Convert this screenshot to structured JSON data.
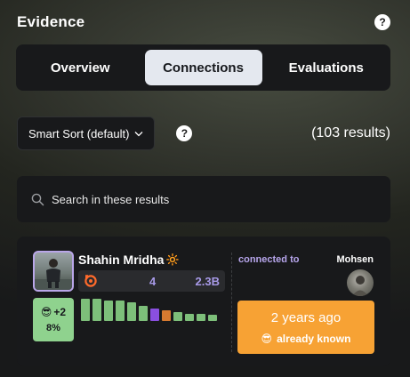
{
  "header": {
    "title": "Evidence",
    "help_icon": "?"
  },
  "tabs": [
    {
      "label": "Overview",
      "active": false
    },
    {
      "label": "Connections",
      "active": true
    },
    {
      "label": "Evaluations",
      "active": false
    }
  ],
  "sort": {
    "label": "Smart Sort (default)",
    "help_icon": "?"
  },
  "results": {
    "text": "(103 results)"
  },
  "search": {
    "placeholder": "Search in these results"
  },
  "card": {
    "name": "Shahin Mridha",
    "name_emoji": "🔆",
    "stat_a": "4",
    "stat_b": "2.3B",
    "badge_emoji": "😎",
    "badge_delta": "+2",
    "badge_percent": "8%",
    "bars": [
      {
        "value": 0.95,
        "color": "#7dbf7a"
      },
      {
        "value": 0.95,
        "color": "#7dbf7a"
      },
      {
        "value": 0.9,
        "color": "#7dbf7a"
      },
      {
        "value": 0.9,
        "color": "#7dbf7a"
      },
      {
        "value": 0.8,
        "color": "#7dbf7a"
      },
      {
        "value": 0.65,
        "color": "#7dbf7a"
      },
      {
        "value": 0.55,
        "color": "#8a4fe0"
      },
      {
        "value": 0.45,
        "color": "#d77a30"
      },
      {
        "value": 0.38,
        "color": "#7dbf7a"
      },
      {
        "value": 0.3,
        "color": "#7dbf7a"
      },
      {
        "value": 0.3,
        "color": "#7dbf7a"
      },
      {
        "value": 0.25,
        "color": "#7dbf7a"
      }
    ],
    "connected_label": "connected to",
    "connection_name": "Mohsen",
    "known_time": "2 years ago",
    "known_emoji": "😎",
    "known_status": "already known"
  },
  "colors": {
    "accent_purple": "#b7a6ec",
    "badge_green": "#8fd28e",
    "known_orange": "#f7a234",
    "stats_logo": "#ff6a2b"
  }
}
